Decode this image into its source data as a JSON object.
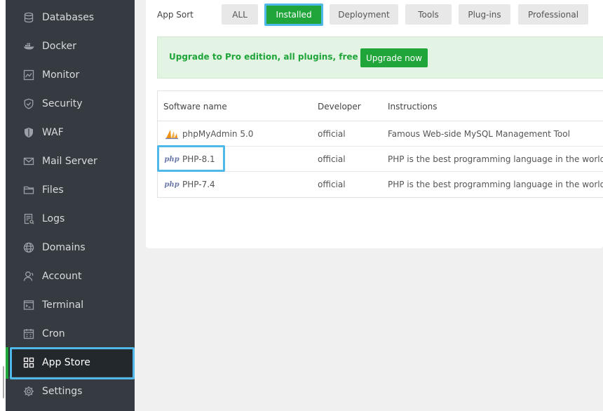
{
  "sidebar": {
    "items": [
      {
        "label": "Databases",
        "icon": "database-icon"
      },
      {
        "label": "Docker",
        "icon": "docker-icon"
      },
      {
        "label": "Monitor",
        "icon": "monitor-icon"
      },
      {
        "label": "Security",
        "icon": "shield-icon"
      },
      {
        "label": "WAF",
        "icon": "waf-shield-icon"
      },
      {
        "label": "Mail Server",
        "icon": "mail-icon"
      },
      {
        "label": "Files",
        "icon": "folder-icon"
      },
      {
        "label": "Logs",
        "icon": "logs-icon"
      },
      {
        "label": "Domains",
        "icon": "globe-icon"
      },
      {
        "label": "Account",
        "icon": "user-icon"
      },
      {
        "label": "Terminal",
        "icon": "terminal-icon"
      },
      {
        "label": "Cron",
        "icon": "calendar-icon"
      },
      {
        "label": "App Store",
        "icon": "grid-icon"
      },
      {
        "label": "Settings",
        "icon": "gear-icon"
      }
    ],
    "active": "App Store"
  },
  "app_sort": {
    "label": "App Sort",
    "tabs": [
      "ALL",
      "Installed",
      "Deployment",
      "Tools",
      "Plug-ins",
      "Professional"
    ],
    "active": "Installed"
  },
  "banner": {
    "text": "Upgrade to Pro edition, all plugins, free to use!",
    "button": "Upgrade now"
  },
  "table": {
    "headers": [
      "Software name",
      "Developer",
      "Instructions"
    ],
    "rows": [
      {
        "icon": "phpmyadmin-icon",
        "name": "phpMyAdmin 5.0",
        "developer": "official",
        "instructions": "Famous Web-side MySQL Management Tool"
      },
      {
        "icon": "php-icon",
        "name": "PHP-8.1",
        "developer": "official",
        "instructions": "PHP is the best programming language in the world"
      },
      {
        "icon": "php-icon",
        "name": "PHP-7.4",
        "developer": "official",
        "instructions": "PHP is the best programming language in the world"
      }
    ],
    "php_logo_text": "php"
  },
  "colors": {
    "sidebar_bg": "#353b40",
    "sidebar_active_bg": "#23282c",
    "accent_green": "#20a53a",
    "highlight_blue": "#4fb8e8"
  }
}
